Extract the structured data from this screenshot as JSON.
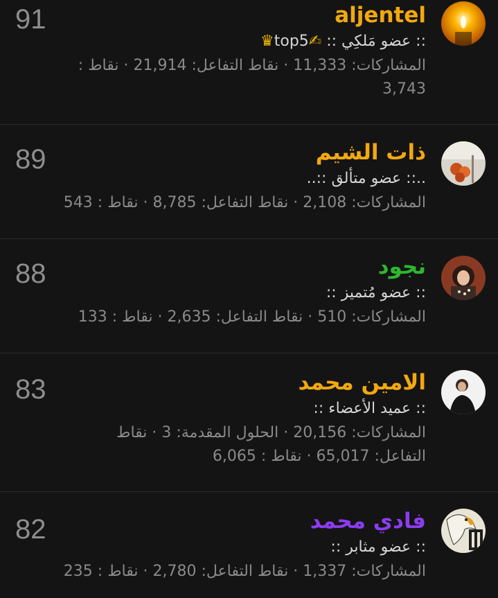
{
  "members": [
    {
      "score": "91",
      "name": "aljentel",
      "name_color": "#f2a80f",
      "rank_prefix": ":: عضو مَلكِي ::",
      "rank_suffix": "top5",
      "crown_icon": "crown-icon",
      "pen_icon": "writing-hand-icon",
      "stats_line1": "المشاركات: 11,333 · نقاط التفاعل: 21,914 · نقاط :",
      "stats_line2": "3,743"
    },
    {
      "score": "89",
      "name": "ذات الشيم",
      "name_color": "#f2a80f",
      "rank_prefix": "..:: عضو متألق ::..",
      "stats_line1": "المشاركات: 2,108 · نقاط التفاعل: 8,785 · نقاط : 543"
    },
    {
      "score": "88",
      "name": "نجود",
      "name_color": "#2eb82e",
      "rank_prefix": ":: عضو مُتميز ::",
      "stats_line1": "المشاركات: 510 · نقاط التفاعل: 2,635 · نقاط : 133"
    },
    {
      "score": "83",
      "name": "الامين محمد",
      "name_color": "#f2a80f",
      "rank_prefix": ":: عميد الأعضاء ::",
      "stats_line1": "المشاركات: 20,156 · الحلول المقدمة: 3 · نقاط",
      "stats_line2": "التفاعل: 65,017 · نقاط : 6,065"
    },
    {
      "score": "82",
      "name": "فادي محمد",
      "name_color": "#8c3cf0",
      "rank_prefix": ":: عضو مثابر ::",
      "stats_line1": "المشاركات: 1,337 · نقاط التفاعل: 2,780 · نقاط : 235"
    }
  ]
}
